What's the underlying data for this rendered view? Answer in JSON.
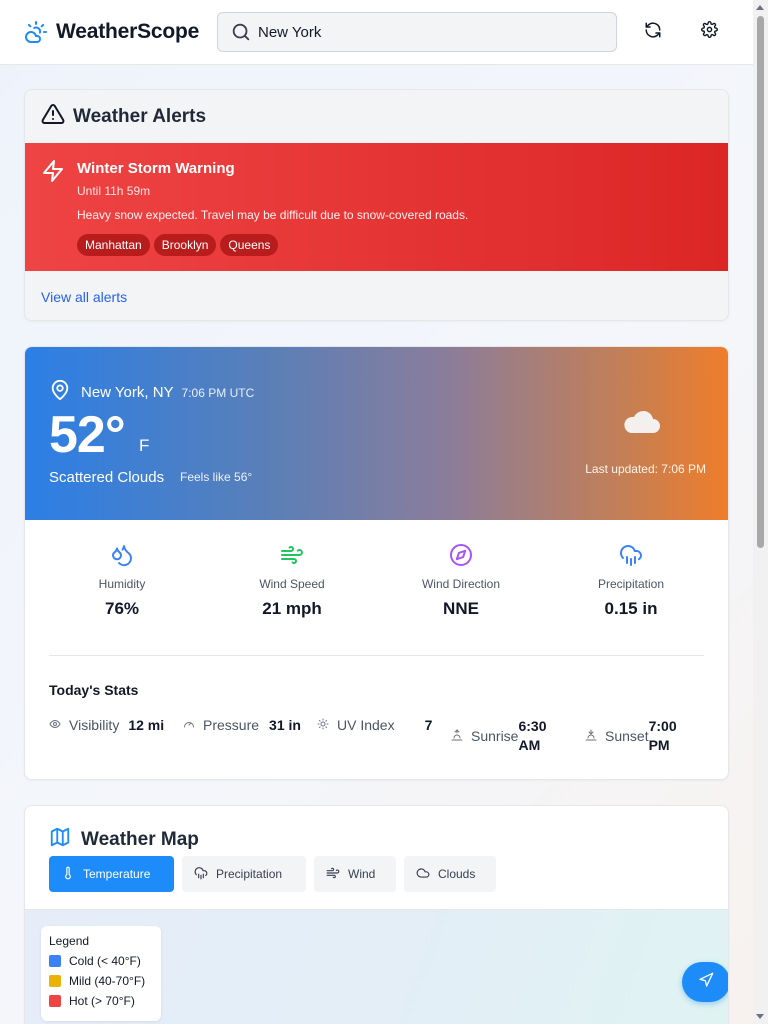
{
  "app": {
    "name": "WeatherScope",
    "icon": "cloud-sun-icon"
  },
  "search": {
    "value": "New York",
    "icon": "search-icon"
  },
  "header_actions": [
    {
      "icon": "refresh-icon"
    },
    {
      "icon": "gear-icon"
    }
  ],
  "alerts": {
    "title": "Weather Alerts",
    "icon": "warning-triangle-icon",
    "items": [
      {
        "icon": "lightning-icon",
        "title": "Winter Storm Warning",
        "until": "Until 11h 59m",
        "description": "Heavy snow expected. Travel may be difficult due to snow-covered roads.",
        "areas": [
          "Manhattan",
          "Brooklyn",
          "Queens"
        ]
      }
    ],
    "view_all": "View all alerts",
    "colors": {
      "alert_bg": "#ef4444",
      "link": "#2563eb"
    }
  },
  "current": {
    "location": "New York, NY",
    "local_time": "7:06 PM UTC",
    "temperature": "52°",
    "unit": "F",
    "condition": "Scattered Clouds",
    "feels_like": "Feels like 56°",
    "last_updated": "Last updated: 7:06 PM",
    "condition_icon": "cloud-icon",
    "metrics": [
      {
        "icon": "droplets-icon",
        "label": "Humidity",
        "value": "76%",
        "color": "#3b82f6"
      },
      {
        "icon": "wind-icon",
        "label": "Wind Speed",
        "value": "21 mph",
        "color": "#22c55e"
      },
      {
        "icon": "compass-icon",
        "label": "Wind Direction",
        "value": "NNE",
        "color": "#a855f7"
      },
      {
        "icon": "cloud-rain-icon",
        "label": "Precipitation",
        "value": "0.15 in",
        "color": "#3b82f6"
      }
    ],
    "stats_title": "Today's Stats",
    "stats": [
      {
        "icon": "eye-icon",
        "label": "Visibility",
        "value": "12 mi"
      },
      {
        "icon": "gauge-icon",
        "label": "Pressure",
        "value": "31 in"
      },
      {
        "icon": "sun-icon",
        "label": "UV Index",
        "value": "7"
      },
      {
        "icon": "sunrise-icon",
        "label": "Sunrise",
        "value": "6:30 AM"
      },
      {
        "icon": "sunset-icon",
        "label": "Sunset",
        "value": "7:00 PM"
      }
    ]
  },
  "map": {
    "title": "Weather Map",
    "icon": "map-icon",
    "tabs": [
      {
        "label": "Temperature",
        "icon": "thermometer-icon",
        "active": true
      },
      {
        "label": "Precipitation",
        "icon": "cloud-rain-icon",
        "active": false
      },
      {
        "label": "Wind",
        "icon": "wind-icon",
        "active": false
      },
      {
        "label": "Clouds",
        "icon": "cloud-icon",
        "active": false
      }
    ],
    "legend": {
      "title": "Legend",
      "items": [
        {
          "label": "Cold (< 40°F)",
          "color": "#3b82f6"
        },
        {
          "label": "Mild (40-70°F)",
          "color": "#eab308"
        },
        {
          "label": "Hot (> 70°F)",
          "color": "#ef4444"
        }
      ]
    },
    "locate_button_icon": "navigation-icon",
    "accent": "#1d8cf8"
  }
}
